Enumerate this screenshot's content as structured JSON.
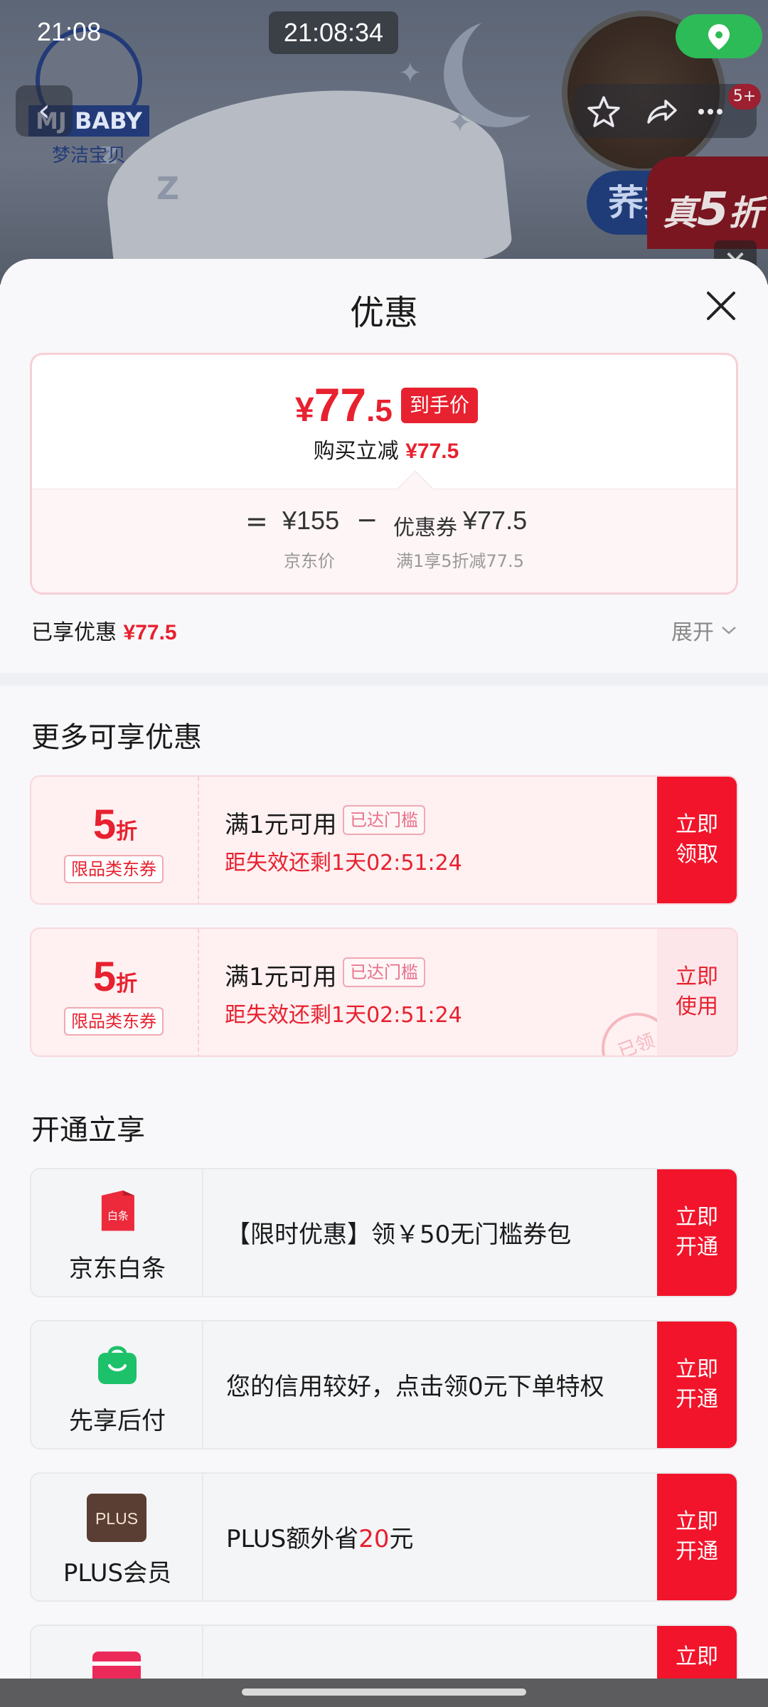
{
  "status_bar": {
    "time": "21:08",
    "clock": "21:08:34"
  },
  "product": {
    "brand_word": "MJ BABY",
    "brand_cn": "梦洁宝贝",
    "badge_qm": "荞麦",
    "badge_discount_prefix": "真",
    "badge_discount_num": "5",
    "badge_discount_suffix": "折",
    "more_badge": "5+"
  },
  "sheet": {
    "title": "优惠",
    "price": {
      "currency": "¥",
      "int": "77",
      "dec": ".5",
      "tag": "到手价"
    },
    "save_text": "购买立减",
    "save_value": "¥77.5",
    "formula": {
      "eq": "=",
      "jd_price": "¥155",
      "minus": "−",
      "coupon_label": "优惠券",
      "coupon_value": "¥77.5",
      "jd_label": "京东价",
      "coupon_desc": "满1享5折减77.5"
    },
    "enjoyed_label": "已享优惠",
    "enjoyed_value": "¥77.5",
    "expand_label": "展开"
  },
  "more_deals": {
    "title": "更多可享优惠",
    "coupons": [
      {
        "num": "5",
        "unit": "折",
        "category": "限品类东券",
        "condition": "满1元可用",
        "reached": "已达门槛",
        "timer": "距失效还剩1天02:51:24",
        "button": "立即领取"
      },
      {
        "num": "5",
        "unit": "折",
        "category": "限品类东券",
        "condition": "满1元可用",
        "reached": "已达门槛",
        "timer": "距失效还剩1天02:51:24",
        "button": "立即使用",
        "stamp": "已领"
      }
    ]
  },
  "activate": {
    "title": "开通立享",
    "items": [
      {
        "name": "京东白条",
        "icon_text": "白条",
        "desc": "【限时优惠】领￥50无门槛券包",
        "button": "立即开通"
      },
      {
        "name": "先享后付",
        "desc": "您的信用较好，点击领0元下单特权",
        "button": "立即开通"
      },
      {
        "name": "PLUS会员",
        "icon_text": "PLUS",
        "desc_pre": "PLUS额外省",
        "desc_num": "20",
        "desc_post": "元",
        "button": "立即开通"
      },
      {
        "button": "立即"
      }
    ]
  },
  "colors": {
    "accent": "#e7212f",
    "button_red": "#f2142a"
  }
}
